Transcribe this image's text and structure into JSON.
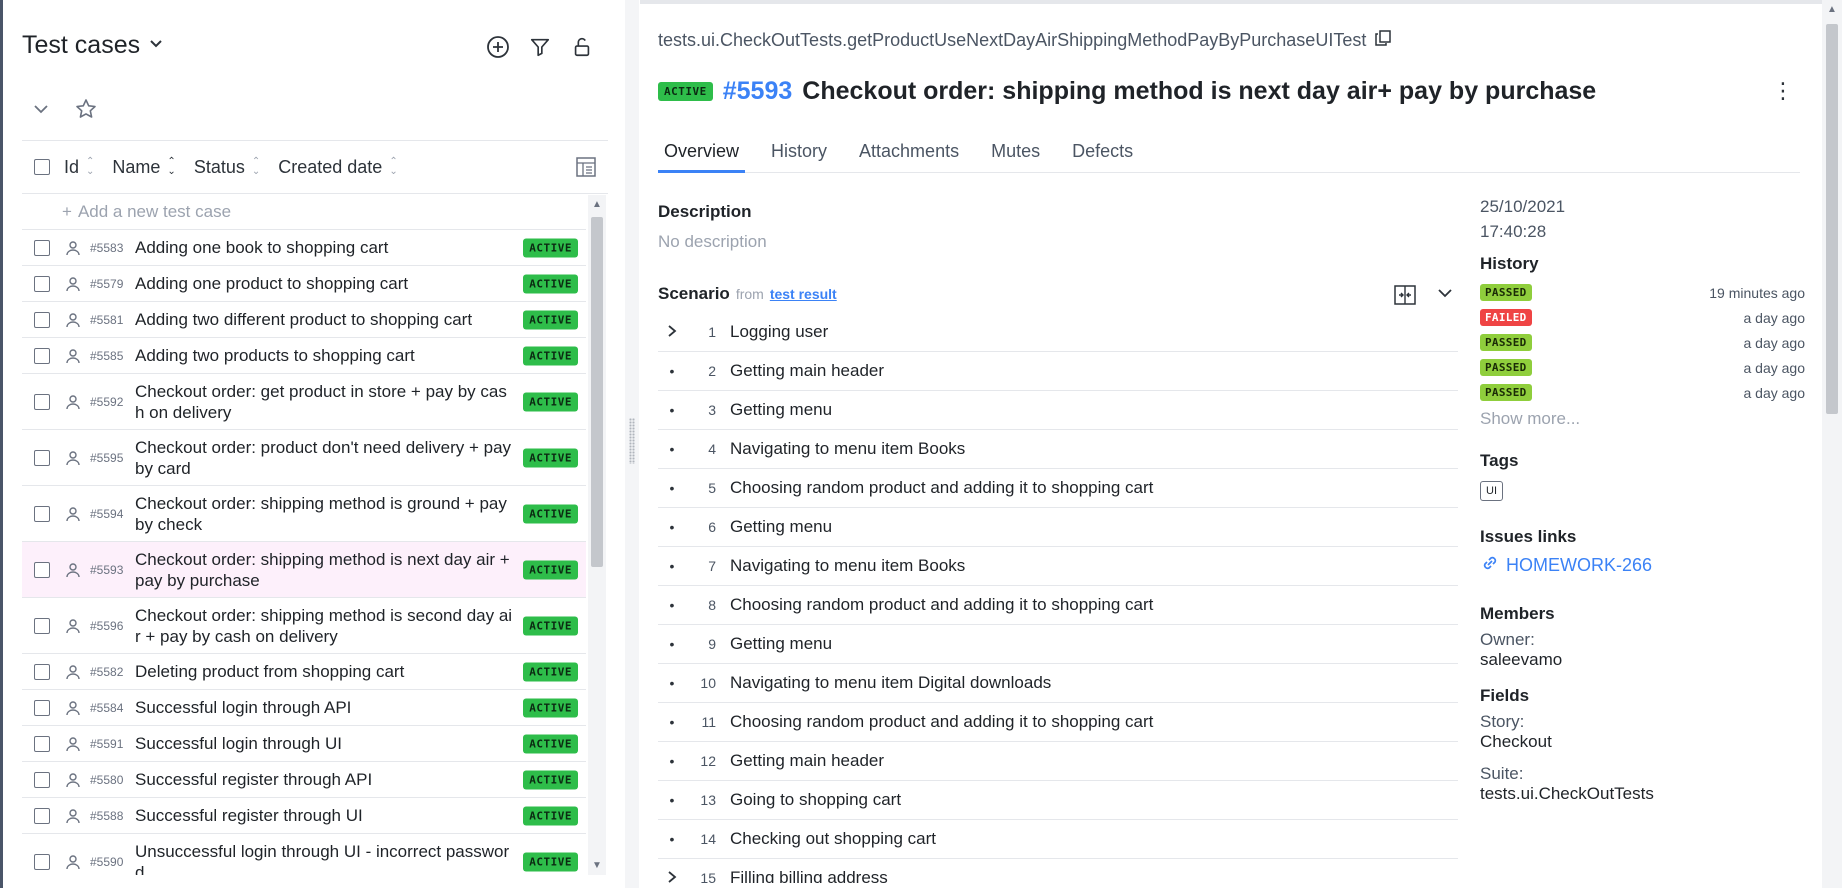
{
  "left": {
    "title": "Test cases",
    "add_row": "Add a new test case",
    "columns": {
      "id": "Id",
      "name": "Name",
      "status": "Status",
      "created": "Created date"
    },
    "rows": [
      {
        "id": "#5583",
        "name": "Adding one book to shopping cart",
        "status": "ACTIVE",
        "lines": 1
      },
      {
        "id": "#5579",
        "name": "Adding one product to shopping cart",
        "status": "ACTIVE",
        "lines": 1
      },
      {
        "id": "#5581",
        "name": "Adding two different product to shopping cart",
        "status": "ACTIVE",
        "lines": 1
      },
      {
        "id": "#5585",
        "name": "Adding two products to shopping cart",
        "status": "ACTIVE",
        "lines": 1
      },
      {
        "id": "#5592",
        "name": "Checkout order: get product in store + pay by cash on delivery",
        "status": "ACTIVE",
        "lines": 2
      },
      {
        "id": "#5595",
        "name": "Checkout order: product don't need delivery + pay by card",
        "status": "ACTIVE",
        "lines": 2
      },
      {
        "id": "#5594",
        "name": "Checkout order: shipping method is ground + pay by check",
        "status": "ACTIVE",
        "lines": 2
      },
      {
        "id": "#5593",
        "name": "Checkout order: shipping method is next day air + pay by purchase",
        "status": "ACTIVE",
        "lines": 2,
        "selected": true
      },
      {
        "id": "#5596",
        "name": "Checkout order: shipping method is second day air + pay by cash on delivery",
        "status": "ACTIVE",
        "lines": 2
      },
      {
        "id": "#5582",
        "name": "Deleting product from shopping cart",
        "status": "ACTIVE",
        "lines": 1
      },
      {
        "id": "#5584",
        "name": "Successful login through API",
        "status": "ACTIVE",
        "lines": 1
      },
      {
        "id": "#5591",
        "name": "Successful login through UI",
        "status": "ACTIVE",
        "lines": 1
      },
      {
        "id": "#5580",
        "name": "Successful register through API",
        "status": "ACTIVE",
        "lines": 1
      },
      {
        "id": "#5588",
        "name": "Successful register through UI",
        "status": "ACTIVE",
        "lines": 1
      },
      {
        "id": "#5590",
        "name": "Unsuccessful login through UI - incorrect password",
        "status": "ACTIVE",
        "lines": 2
      }
    ]
  },
  "right": {
    "path": "tests.ui.CheckOutTests.getProductUseNextDayAirShippingMethodPayByPurchaseUITest",
    "status": "ACTIVE",
    "number": "#5593",
    "title": "Checkout order: shipping method is next day air+ pay by purchase",
    "tabs": [
      "Overview",
      "History",
      "Attachments",
      "Mutes",
      "Defects"
    ],
    "description_label": "Description",
    "description_value": "No description",
    "scenario_label": "Scenario",
    "scenario_from": "from",
    "scenario_link": "test result",
    "steps": [
      {
        "n": "1",
        "text": "Logging user",
        "expandable": true
      },
      {
        "n": "2",
        "text": "Getting main header"
      },
      {
        "n": "3",
        "text": "Getting menu"
      },
      {
        "n": "4",
        "text": "Navigating to menu item Books"
      },
      {
        "n": "5",
        "text": "Choosing random product and adding it to shopping cart"
      },
      {
        "n": "6",
        "text": "Getting menu"
      },
      {
        "n": "7",
        "text": "Navigating to menu item Books"
      },
      {
        "n": "8",
        "text": "Choosing random product and adding it to shopping cart"
      },
      {
        "n": "9",
        "text": "Getting menu"
      },
      {
        "n": "10",
        "text": "Navigating to menu item Digital downloads"
      },
      {
        "n": "11",
        "text": "Choosing random product and adding it to shopping cart"
      },
      {
        "n": "12",
        "text": "Getting main header"
      },
      {
        "n": "13",
        "text": "Going to shopping cart"
      },
      {
        "n": "14",
        "text": "Checking out shopping cart"
      },
      {
        "n": "15",
        "text": "Filling billing address",
        "expandable": true
      }
    ],
    "side": {
      "date": "25/10/2021",
      "time": "17:40:28",
      "history_label": "History",
      "history": [
        {
          "status": "PASSED",
          "time": "19 minutes ago"
        },
        {
          "status": "FAILED",
          "time": "a day ago"
        },
        {
          "status": "PASSED",
          "time": "a day ago"
        },
        {
          "status": "PASSED",
          "time": "a day ago"
        },
        {
          "status": "PASSED",
          "time": "a day ago"
        }
      ],
      "show_more": "Show more...",
      "tags_label": "Tags",
      "tags": [
        "UI"
      ],
      "issues_label": "Issues links",
      "issue": "HOMEWORK-266",
      "members_label": "Members",
      "owner_label": "Owner:",
      "owner_value": "saleevamo",
      "fields_label": "Fields",
      "story_label": "Story:",
      "story_value": "Checkout",
      "suite_label": "Suite:",
      "suite_value": "tests.ui.CheckOutTests"
    }
  },
  "colors": {
    "accent": "#3b82f6",
    "active": "#2ebd4a",
    "passed": "#8fce3c",
    "failed": "#ef4444",
    "selected_row": "#fdf0fb"
  }
}
